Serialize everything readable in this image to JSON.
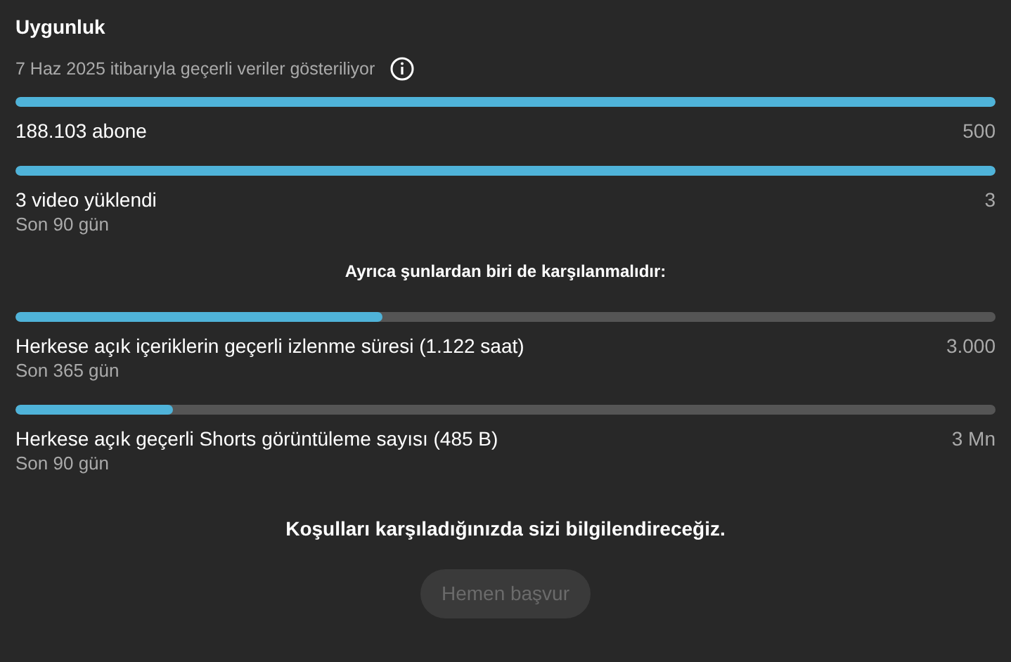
{
  "title": "Uygunluk",
  "subtitle": "7 Haz 2025 itibarıyla geçerli veriler gösteriliyor",
  "requirements": [
    {
      "label": "188.103 abone",
      "target": "500",
      "level": 1
    },
    {
      "label": "3 video yüklendi",
      "period": "Son 90 gün",
      "target": "3",
      "level": 1
    }
  ],
  "alternatives_heading": "Ayrıca şunlardan biri de karşılanmalıdır:",
  "alternatives": [
    {
      "label": "Herkese açık içeriklerin geçerli izlenme süresi (1.122 saat)",
      "period": "Son 365 gün",
      "target": "3.000",
      "level": 0.374
    },
    {
      "label": "Herkese açık geçerli Shorts görüntüleme sayısı (485 B)",
      "period": "Son 90 gün",
      "target": "3 Mn",
      "level": 0.16
    }
  ],
  "notice": "Koşulları karşıladığınızda sizi bilgilendireceğiz.",
  "apply_button": {
    "label": "Hemen başvur",
    "disabled": true
  }
}
